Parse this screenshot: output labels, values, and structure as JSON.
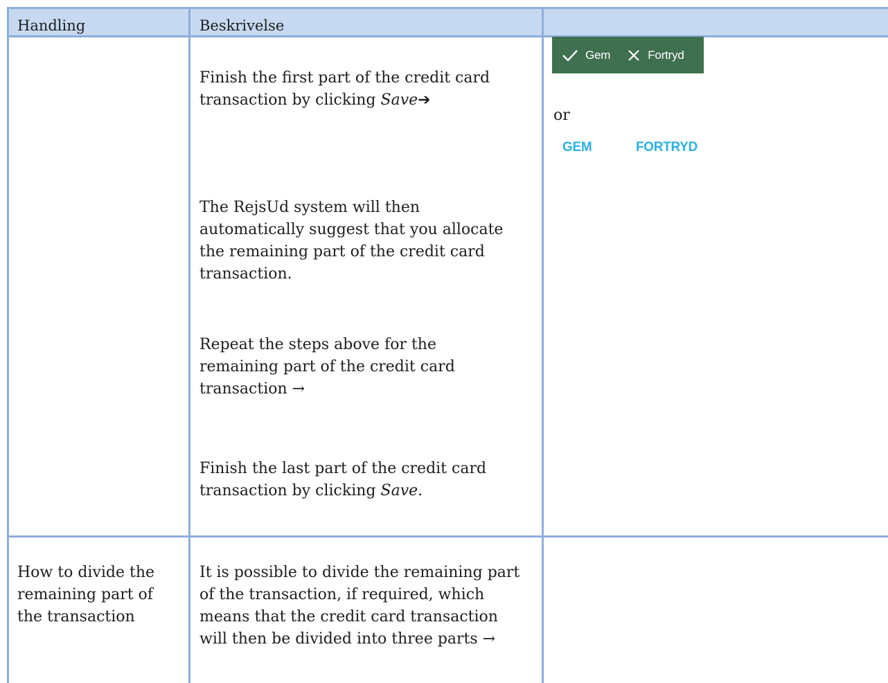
{
  "header": {
    "col1": "Handling",
    "col2": "Beskrivelse",
    "col3": ""
  },
  "row1": {
    "para1_a": "Finish the first part of the credit card transaction by clicking ",
    "para1_em": "Save",
    "para1_arrow": "➔",
    "para2": "The RejsUd system will then automatically suggest that you allocate the remaining part of the credit card transaction.",
    "para3": "Repeat the steps above for the remaining part of the credit card transaction →",
    "para4_a": "Finish the last part of the credit card transaction by clicking ",
    "para4_em": "Save",
    "para4_end": ".",
    "green_buttons": {
      "save_label": "Gem",
      "cancel_label": "Fortryd"
    },
    "or_text": "or",
    "flat_buttons": {
      "save_label": "GEM",
      "cancel_label": "FORTRYD"
    }
  },
  "row2": {
    "action": "How to divide the remaining part of the transaction",
    "description": "It is possible to divide the remaining part of the transaction, if required, which means that the credit card transaction will then be divided into three parts →"
  },
  "colors": {
    "header_bg": "#c6d9f1",
    "grid": "#8eaedc",
    "green_bar": "#3f7050",
    "flat_button_text": "#2bb0e3"
  }
}
